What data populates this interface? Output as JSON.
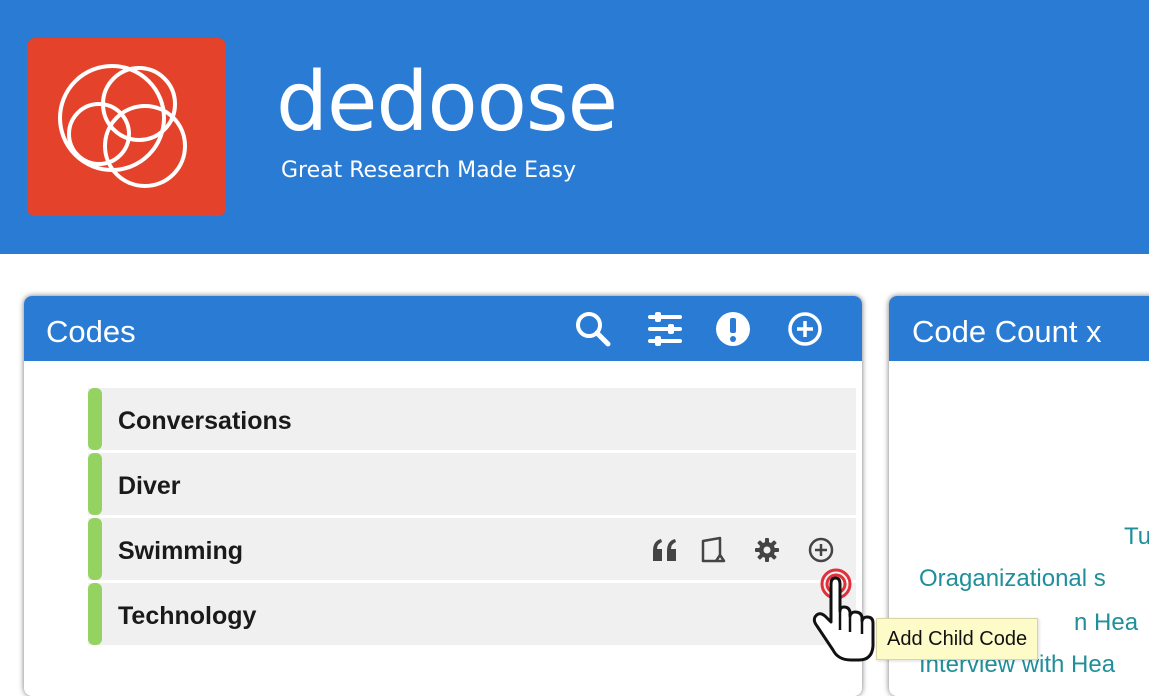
{
  "brand": {
    "name": "dedoose",
    "tagline": "Great Research Made Easy",
    "header_color": "#2a7bd4",
    "logo_color": "#e5422b"
  },
  "codes_panel": {
    "title": "Codes",
    "icons": [
      "search-icon",
      "filter-sliders-icon",
      "alert-icon",
      "add-circle-icon"
    ],
    "items": [
      {
        "label": "Conversations",
        "color": "#94d262"
      },
      {
        "label": "Diver",
        "color": "#94d262"
      },
      {
        "label": "Swimming",
        "color": "#94d262",
        "hovered": true
      },
      {
        "label": "Technology",
        "color": "#94d262"
      }
    ],
    "row_actions": [
      "quote-icon",
      "memo-icon",
      "gear-icon",
      "add-child-icon"
    ]
  },
  "count_panel": {
    "title": "Code Count x",
    "lines": [
      "Tu",
      "Oraganizational s",
      "n Hea",
      "Interview with Hea"
    ]
  },
  "tooltip": {
    "text": "Add Child Code"
  }
}
